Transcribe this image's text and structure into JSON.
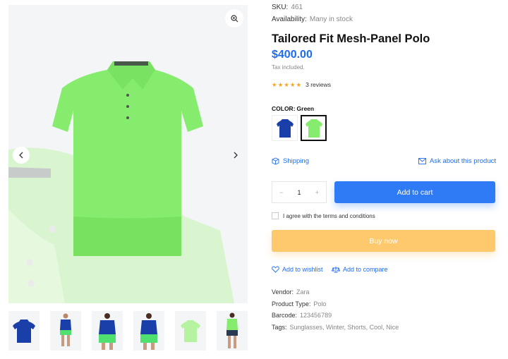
{
  "product": {
    "sku_label": "SKU:",
    "sku": "461",
    "availability_label": "Availability:",
    "availability": "Many in stock",
    "title": "Tailored Fit Mesh-Panel Polo",
    "price": "$400.00",
    "tax_note": "Tax included.",
    "rating": 5,
    "reviews": "3 reviews"
  },
  "color": {
    "label": "COLOR:",
    "selected": "Green",
    "swatches": [
      {
        "name": "Blue",
        "hex": "#1a3fa8"
      },
      {
        "name": "Green",
        "hex": "#86ec6e"
      }
    ]
  },
  "links": {
    "shipping": "Shipping",
    "ask": "Ask about this product",
    "wishlist": "Add to wishlist",
    "compare": "Add to compare"
  },
  "purchase": {
    "quantity": "1",
    "minus": "−",
    "plus": "+",
    "add_to_cart": "Add to cart",
    "agree_text": "I agree with the terms and conditions",
    "buy_now": "Buy now"
  },
  "details": {
    "vendor_label": "Vendor:",
    "vendor": "Zara",
    "type_label": "Product Type:",
    "type": "Polo",
    "barcode_label": "Barcode:",
    "barcode": "123456789",
    "tags_label": "Tags:",
    "tags": "Sunglasses, Winter, Shorts, Cool, Nice"
  },
  "gallery": {
    "thumbnails": [
      "blue-polo",
      "model-blue-polo-green-shorts",
      "model-blue-polo-green-shorts",
      "model-blue-polo-green-shorts",
      "green-polo",
      "model-green-polo"
    ]
  },
  "colors": {
    "accent": "#2f7af5",
    "price": "#1e6cf0",
    "buy_now": "#fdc96c",
    "star": "#f5a623",
    "polo_green": "#86ec6e",
    "polo_blue": "#1a3fa8"
  }
}
